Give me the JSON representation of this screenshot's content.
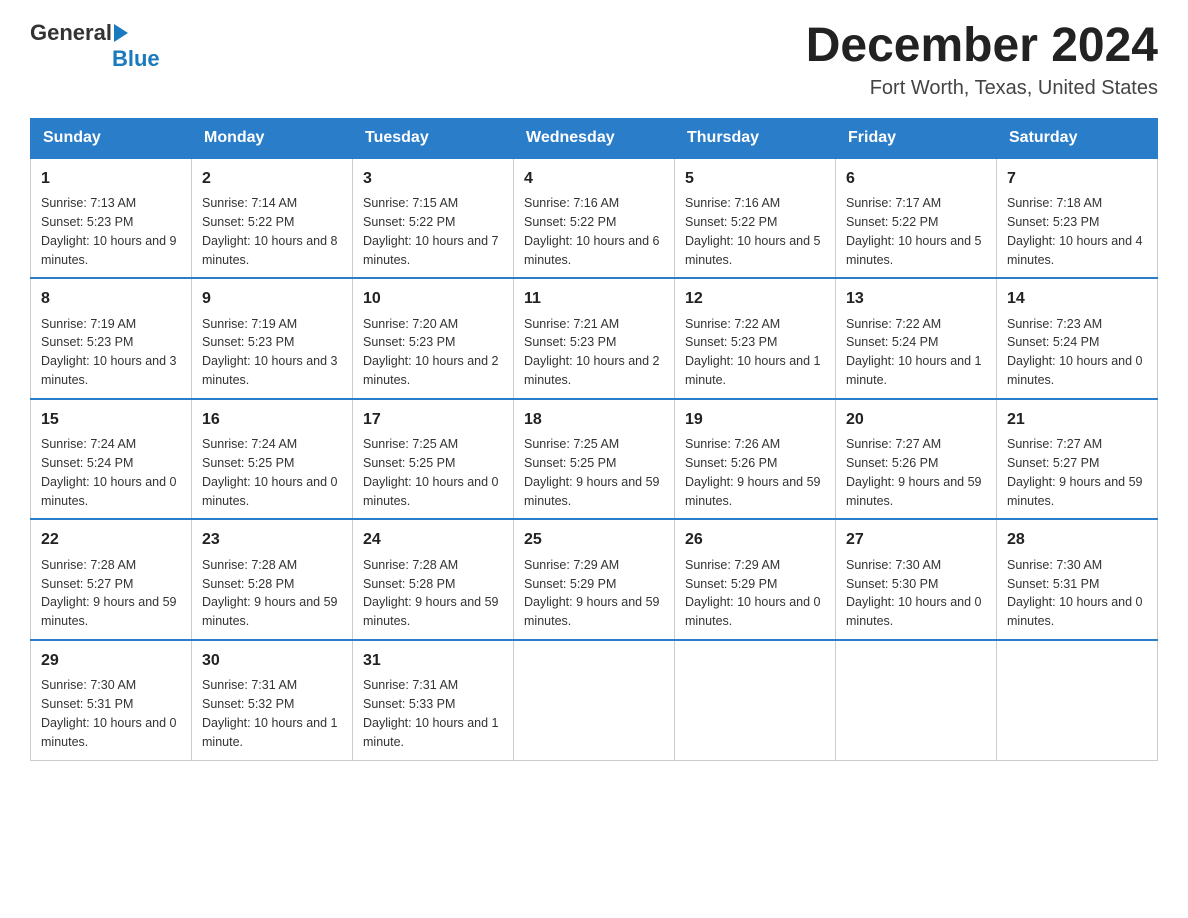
{
  "header": {
    "logo_general": "General",
    "logo_blue": "Blue",
    "month_title": "December 2024",
    "location": "Fort Worth, Texas, United States"
  },
  "days_of_week": [
    "Sunday",
    "Monday",
    "Tuesday",
    "Wednesday",
    "Thursday",
    "Friday",
    "Saturday"
  ],
  "weeks": [
    [
      {
        "day": "1",
        "sunrise": "7:13 AM",
        "sunset": "5:23 PM",
        "daylight": "10 hours and 9 minutes."
      },
      {
        "day": "2",
        "sunrise": "7:14 AM",
        "sunset": "5:22 PM",
        "daylight": "10 hours and 8 minutes."
      },
      {
        "day": "3",
        "sunrise": "7:15 AM",
        "sunset": "5:22 PM",
        "daylight": "10 hours and 7 minutes."
      },
      {
        "day": "4",
        "sunrise": "7:16 AM",
        "sunset": "5:22 PM",
        "daylight": "10 hours and 6 minutes."
      },
      {
        "day": "5",
        "sunrise": "7:16 AM",
        "sunset": "5:22 PM",
        "daylight": "10 hours and 5 minutes."
      },
      {
        "day": "6",
        "sunrise": "7:17 AM",
        "sunset": "5:22 PM",
        "daylight": "10 hours and 5 minutes."
      },
      {
        "day": "7",
        "sunrise": "7:18 AM",
        "sunset": "5:23 PM",
        "daylight": "10 hours and 4 minutes."
      }
    ],
    [
      {
        "day": "8",
        "sunrise": "7:19 AM",
        "sunset": "5:23 PM",
        "daylight": "10 hours and 3 minutes."
      },
      {
        "day": "9",
        "sunrise": "7:19 AM",
        "sunset": "5:23 PM",
        "daylight": "10 hours and 3 minutes."
      },
      {
        "day": "10",
        "sunrise": "7:20 AM",
        "sunset": "5:23 PM",
        "daylight": "10 hours and 2 minutes."
      },
      {
        "day": "11",
        "sunrise": "7:21 AM",
        "sunset": "5:23 PM",
        "daylight": "10 hours and 2 minutes."
      },
      {
        "day": "12",
        "sunrise": "7:22 AM",
        "sunset": "5:23 PM",
        "daylight": "10 hours and 1 minute."
      },
      {
        "day": "13",
        "sunrise": "7:22 AM",
        "sunset": "5:24 PM",
        "daylight": "10 hours and 1 minute."
      },
      {
        "day": "14",
        "sunrise": "7:23 AM",
        "sunset": "5:24 PM",
        "daylight": "10 hours and 0 minutes."
      }
    ],
    [
      {
        "day": "15",
        "sunrise": "7:24 AM",
        "sunset": "5:24 PM",
        "daylight": "10 hours and 0 minutes."
      },
      {
        "day": "16",
        "sunrise": "7:24 AM",
        "sunset": "5:25 PM",
        "daylight": "10 hours and 0 minutes."
      },
      {
        "day": "17",
        "sunrise": "7:25 AM",
        "sunset": "5:25 PM",
        "daylight": "10 hours and 0 minutes."
      },
      {
        "day": "18",
        "sunrise": "7:25 AM",
        "sunset": "5:25 PM",
        "daylight": "9 hours and 59 minutes."
      },
      {
        "day": "19",
        "sunrise": "7:26 AM",
        "sunset": "5:26 PM",
        "daylight": "9 hours and 59 minutes."
      },
      {
        "day": "20",
        "sunrise": "7:27 AM",
        "sunset": "5:26 PM",
        "daylight": "9 hours and 59 minutes."
      },
      {
        "day": "21",
        "sunrise": "7:27 AM",
        "sunset": "5:27 PM",
        "daylight": "9 hours and 59 minutes."
      }
    ],
    [
      {
        "day": "22",
        "sunrise": "7:28 AM",
        "sunset": "5:27 PM",
        "daylight": "9 hours and 59 minutes."
      },
      {
        "day": "23",
        "sunrise": "7:28 AM",
        "sunset": "5:28 PM",
        "daylight": "9 hours and 59 minutes."
      },
      {
        "day": "24",
        "sunrise": "7:28 AM",
        "sunset": "5:28 PM",
        "daylight": "9 hours and 59 minutes."
      },
      {
        "day": "25",
        "sunrise": "7:29 AM",
        "sunset": "5:29 PM",
        "daylight": "9 hours and 59 minutes."
      },
      {
        "day": "26",
        "sunrise": "7:29 AM",
        "sunset": "5:29 PM",
        "daylight": "10 hours and 0 minutes."
      },
      {
        "day": "27",
        "sunrise": "7:30 AM",
        "sunset": "5:30 PM",
        "daylight": "10 hours and 0 minutes."
      },
      {
        "day": "28",
        "sunrise": "7:30 AM",
        "sunset": "5:31 PM",
        "daylight": "10 hours and 0 minutes."
      }
    ],
    [
      {
        "day": "29",
        "sunrise": "7:30 AM",
        "sunset": "5:31 PM",
        "daylight": "10 hours and 0 minutes."
      },
      {
        "day": "30",
        "sunrise": "7:31 AM",
        "sunset": "5:32 PM",
        "daylight": "10 hours and 1 minute."
      },
      {
        "day": "31",
        "sunrise": "7:31 AM",
        "sunset": "5:33 PM",
        "daylight": "10 hours and 1 minute."
      },
      null,
      null,
      null,
      null
    ]
  ],
  "labels": {
    "sunrise": "Sunrise:",
    "sunset": "Sunset:",
    "daylight": "Daylight:"
  }
}
